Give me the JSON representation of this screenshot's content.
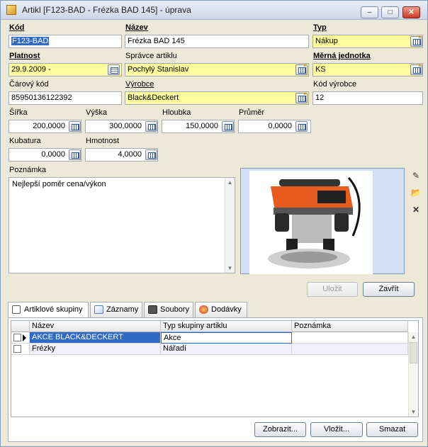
{
  "window": {
    "title": "Artikl [F123-BAD - Frézka BAD 145] - úprava",
    "minimize": "–",
    "maximize": "□",
    "close": "✕"
  },
  "fields": {
    "kod": {
      "label": "Kód",
      "value": "F123-BAD"
    },
    "nazev": {
      "label": "Název",
      "value": "Frézka BAD 145"
    },
    "typ": {
      "label": "Typ",
      "value": "Nákup"
    },
    "platnost": {
      "label": "Platnost",
      "value": "29.9.2009 -"
    },
    "spravce": {
      "label": "Správce artiklu",
      "value": "Pochylý Stanislav"
    },
    "merna_jednotka": {
      "label": "Měrná jednotka",
      "value": "KS"
    },
    "carovy_kod": {
      "label": "Čárový kód",
      "value": "85950136122392"
    },
    "vyrobce": {
      "label": "Výrobce",
      "value": "Black&Deckert"
    },
    "kod_vyrobce": {
      "label": "Kód výrobce",
      "value": "12"
    },
    "sirka": {
      "label": "Šířka",
      "value": "200,0000"
    },
    "vyska": {
      "label": "Výška",
      "value": "300,0000"
    },
    "hloubka": {
      "label": "Hloubka",
      "value": "150,0000"
    },
    "prumer": {
      "label": "Průměr",
      "value": "0,0000"
    },
    "kubatura": {
      "label": "Kubatura",
      "value": "0,0000"
    },
    "hmotnost": {
      "label": "Hmotnost",
      "value": "4,0000"
    },
    "poznamka": {
      "label": "Poznámka",
      "value": "Nejlepší poměr cena/výkon"
    }
  },
  "buttons": {
    "ulozit": "Uložit",
    "zavrit": "Zavřít",
    "zobrazit": "Zobrazit...",
    "vlozit": "Vložit...",
    "smazat": "Smazat"
  },
  "tabs": [
    {
      "label": "Artiklové skupiny",
      "active": true,
      "icon": "groups-icon"
    },
    {
      "label": "Záznamy",
      "active": false,
      "icon": "records-icon"
    },
    {
      "label": "Soubory",
      "active": false,
      "icon": "files-icon"
    },
    {
      "label": "Dodávky",
      "active": false,
      "icon": "deliveries-icon"
    }
  ],
  "grid": {
    "columns": [
      "Název",
      "Typ skupiny artiklu",
      "Poznámka"
    ],
    "rows": [
      {
        "nazev": "AKCE BLACK&DECKERT",
        "typ": "Akce",
        "poznamka": "",
        "selected": true
      },
      {
        "nazev": "Frézky",
        "typ": "Nářadí",
        "poznamka": "",
        "selected": false
      }
    ]
  },
  "colors": {
    "selection": "#316ac5",
    "required_field": "#fffd9e",
    "window_bg": "#ece9d8"
  }
}
